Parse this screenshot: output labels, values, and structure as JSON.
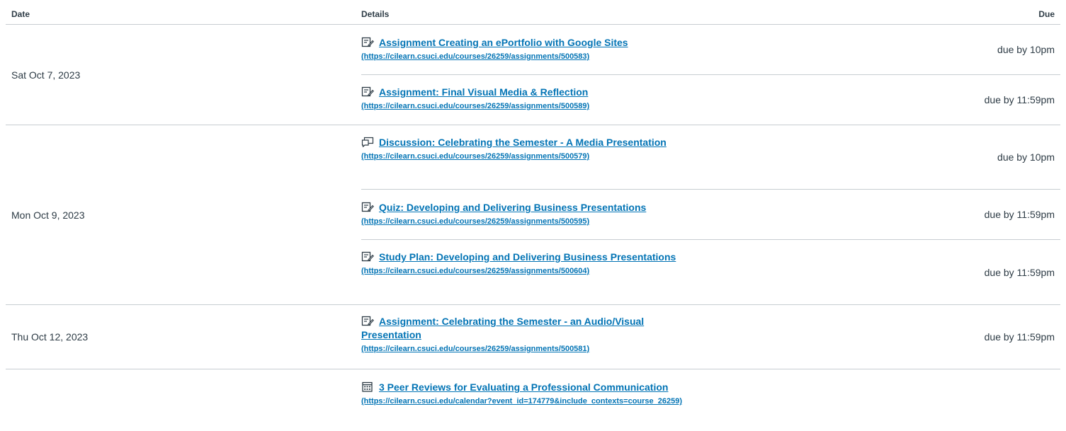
{
  "header": {
    "date_label": "Date",
    "details_label": "Details",
    "due_label": "Due"
  },
  "groups": [
    {
      "date": "Sat Oct 7, 2023",
      "items": [
        {
          "icon": "assignment-icon",
          "title": "Assignment Creating an ePortfolio with Google Sites",
          "url": "(https://cilearn.csuci.edu/courses/26259/assignments/500583)",
          "due": "due by 10pm"
        },
        {
          "icon": "assignment-icon",
          "title": "Assignment: Final Visual Media & Reflection",
          "url": "(https://cilearn.csuci.edu/courses/26259/assignments/500589)",
          "due": "due by 11:59pm"
        }
      ]
    },
    {
      "date": "Mon Oct 9, 2023",
      "items": [
        {
          "icon": "discussion-icon",
          "title": "Discussion: Celebrating the Semester - A Media Presentation",
          "url": "(https://cilearn.csuci.edu/courses/26259/assignments/500579)",
          "due": "due by 10pm"
        },
        {
          "icon": "assignment-icon",
          "title": "Quiz: Developing and Delivering Business Presentations",
          "url": "(https://cilearn.csuci.edu/courses/26259/assignments/500595)",
          "due": "due by 11:59pm"
        },
        {
          "icon": "assignment-icon",
          "title": "Study Plan: Developing and Delivering Business Presentations",
          "url": "(https://cilearn.csuci.edu/courses/26259/assignments/500604)",
          "due": "due by 11:59pm"
        }
      ]
    },
    {
      "date": "Thu Oct 12, 2023",
      "items": [
        {
          "icon": "assignment-icon",
          "title": "Assignment: Celebrating the Semester - an Audio/Visual Presentation",
          "url": "(https://cilearn.csuci.edu/courses/26259/assignments/500581)",
          "due": "due by 11:59pm"
        }
      ]
    },
    {
      "date": "",
      "items": [
        {
          "icon": "calendar-icon",
          "title": "3 Peer Reviews for Evaluating a Professional Communication",
          "url": "(https://cilearn.csuci.edu/calendar?event_id=174779&include_contexts=course_26259)",
          "due": ""
        }
      ]
    }
  ],
  "colors": {
    "link": "#0374b5",
    "text": "#2d3b45",
    "border": "#c7cdd1"
  }
}
